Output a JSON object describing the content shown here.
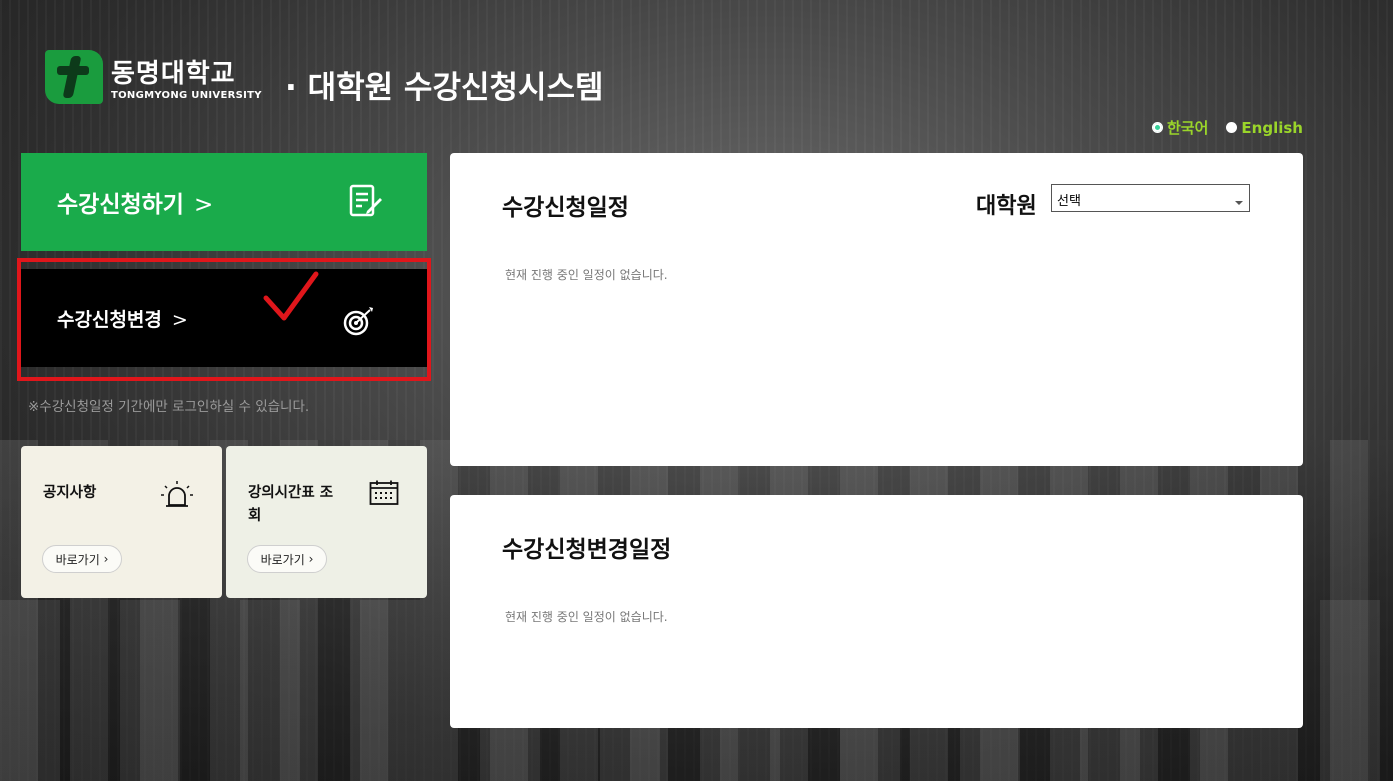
{
  "header": {
    "logo_ko": "동명대학교",
    "logo_en": "TONGMYONG UNIVERSITY",
    "system_title": "· 대학원 수강신청시스템"
  },
  "lang": {
    "korean": "한국어",
    "english": "English",
    "active": "korean"
  },
  "menu": {
    "apply_label": "수강신청하기",
    "change_label": "수강신청변경",
    "chevron": ">",
    "login_notice": "※수강신청일정 기간에만 로그인하실 수 있습니다."
  },
  "cards": [
    {
      "title": "공지사항",
      "button": "바로가기",
      "icon": "alarm-icon"
    },
    {
      "title": "강의시간표 조회",
      "button": "바로가기",
      "icon": "calendar-icon"
    }
  ],
  "panels": {
    "schedule": {
      "title": "수강신청일정",
      "empty": "현재 진행 중인 일정이 없습니다.",
      "filter_label": "대학원",
      "filter_value": "선택"
    },
    "change_schedule": {
      "title": "수강신청변경일정",
      "empty": "현재 진행 중인 일정이 없습니다."
    }
  },
  "colors": {
    "brand_green": "#1aab4b",
    "highlight_red": "#e0161b",
    "lang_green": "#9ad52a"
  }
}
